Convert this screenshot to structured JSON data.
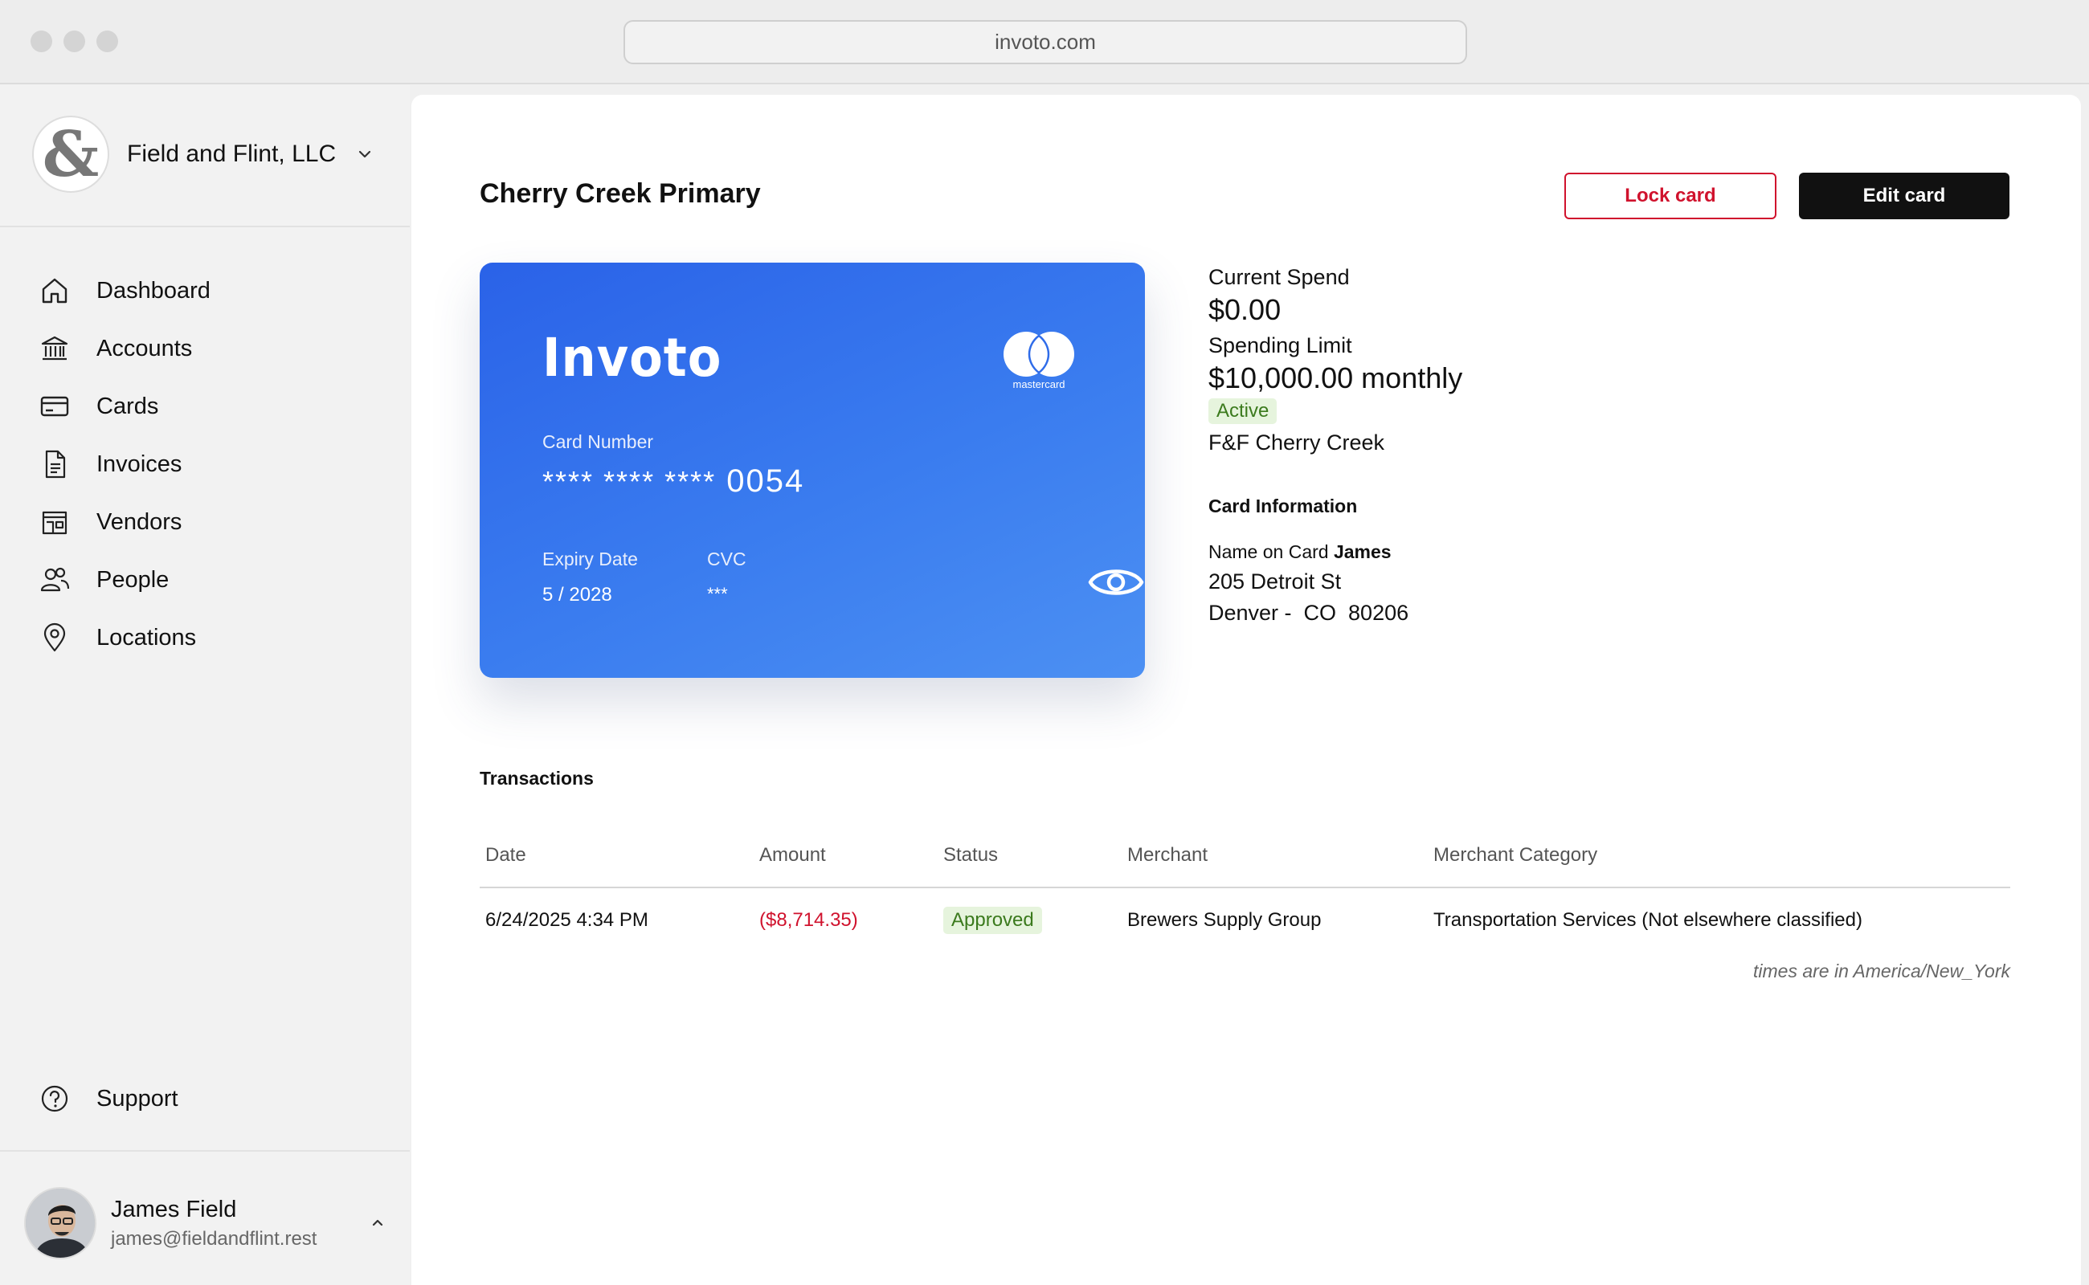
{
  "browser": {
    "url": "invoto.com"
  },
  "org": {
    "name": "Field and Flint, LLC",
    "logo_glyph": "&"
  },
  "nav": {
    "items": [
      {
        "label": "Dashboard",
        "icon": "home-icon"
      },
      {
        "label": "Accounts",
        "icon": "bank-icon"
      },
      {
        "label": "Cards",
        "icon": "credit-card-icon"
      },
      {
        "label": "Invoices",
        "icon": "document-icon"
      },
      {
        "label": "Vendors",
        "icon": "store-icon"
      },
      {
        "label": "People",
        "icon": "people-icon"
      },
      {
        "label": "Locations",
        "icon": "map-pin-icon"
      }
    ],
    "support": "Support"
  },
  "user": {
    "name": "James Field",
    "email": "james@fieldandflint.rest"
  },
  "page": {
    "title": "Cherry Creek Primary"
  },
  "actions": {
    "lock_label": "Lock card",
    "edit_label": "Edit card"
  },
  "card": {
    "brand": "Invoto",
    "network": "mastercard",
    "number_label": "Card Number",
    "number_masked": "**** **** ****",
    "last4": "0054",
    "expiry_label": "Expiry Date",
    "expiry": "5 / 2028",
    "cvc_label": "CVC",
    "cvc": "***"
  },
  "details": {
    "current_spend_label": "Current Spend",
    "current_spend": "$0.00",
    "limit_label": "Spending Limit",
    "limit": "$10,000.00 monthly",
    "status": "Active",
    "location": "F&F Cherry Creek",
    "card_info_heading": "Card Information",
    "name_on_card_label": "Name on Card",
    "name_on_card": "James",
    "address_line1": "205 Detroit St",
    "address_line2": "Denver -  CO  80206"
  },
  "transactions": {
    "title": "Transactions",
    "columns": [
      "Date",
      "Amount",
      "Status",
      "Merchant",
      "Merchant Category"
    ],
    "rows": [
      {
        "date": "6/24/2025 4:34 PM",
        "amount": "($8,714.35)",
        "status": "Approved",
        "merchant": "Brewers Supply Group",
        "category": "Transportation Services (Not elsewhere classified)"
      }
    ],
    "timezone_note": "times are in America/New_York"
  },
  "colors": {
    "accent_red": "#d0122d",
    "card_blue": "#2a62e8",
    "success_bg": "#e6f4dd",
    "success_text": "#3b7a1d"
  }
}
